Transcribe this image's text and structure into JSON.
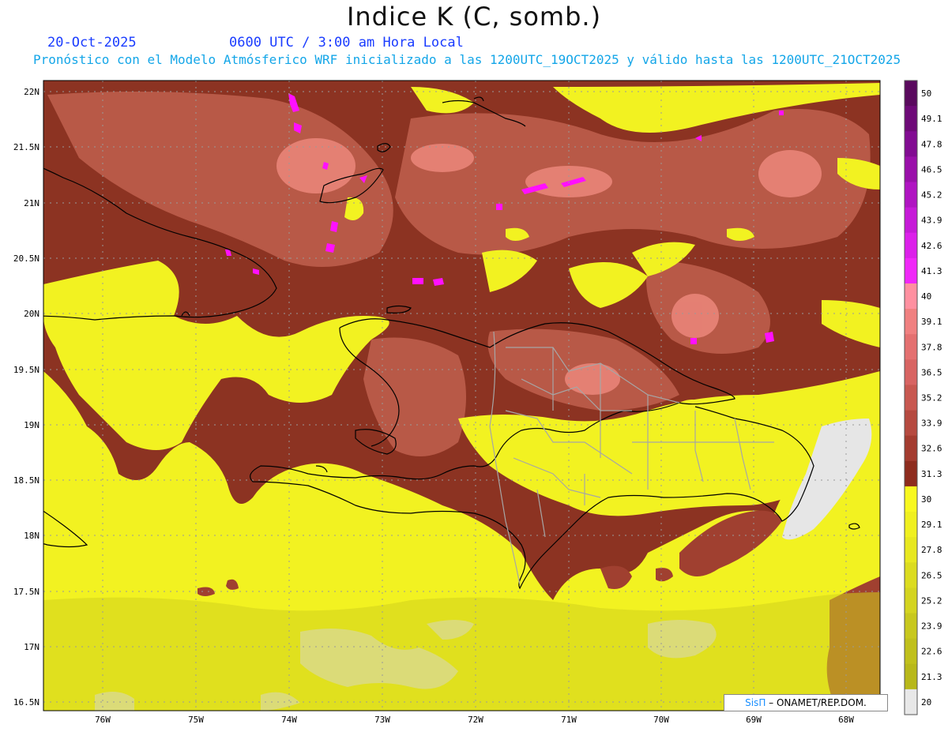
{
  "header": {
    "title": "Indice K (C, somb.)",
    "date": "20-Oct-2025",
    "time": "0600 UTC / 3:00 am Hora Local",
    "forecast_line": "Pronóstico con el Modelo Atmósferico WRF inicializado a las 1200UTC_19OCT2025 y válido hasta las  1200UTC_21OCT2025"
  },
  "map": {
    "lat_labels": [
      "22N",
      "21.5N",
      "21N",
      "20.5N",
      "20N",
      "19.5N",
      "19N",
      "18.5N",
      "18N",
      "17.5N",
      "17N",
      "16.5N"
    ],
    "lon_labels": [
      "76W",
      "75W",
      "74W",
      "73W",
      "72W",
      "71W",
      "70W",
      "69W",
      "68W"
    ],
    "credit": {
      "logo": "SisΠ",
      "text": " – ONAMET/REP.DOM."
    }
  },
  "colorbar": {
    "labels": [
      "50",
      "49.1",
      "47.8",
      "46.5",
      "45.2",
      "43.9",
      "42.6",
      "41.3",
      "40",
      "39.1",
      "37.8",
      "36.5",
      "35.2",
      "33.9",
      "32.6",
      "31.3",
      "30",
      "29.1",
      "27.8",
      "26.5",
      "25.2",
      "23.9",
      "22.6",
      "21.3",
      "20"
    ],
    "colors": [
      "#5a0a5e",
      "#6e0a78",
      "#820c92",
      "#9a10aa",
      "#b014c2",
      "#c61ad8",
      "#dc20ea",
      "#f028f8",
      "#ff90a0",
      "#f08080",
      "#e47070",
      "#d86462",
      "#c85850",
      "#b64a40",
      "#a43c30",
      "#8e2c1e",
      "#f8f820",
      "#f0f020",
      "#e8e820",
      "#dcdc20",
      "#d4d420",
      "#c8c81e",
      "#c0c01c",
      "#b8b81a",
      "#e8e8e8"
    ]
  }
}
